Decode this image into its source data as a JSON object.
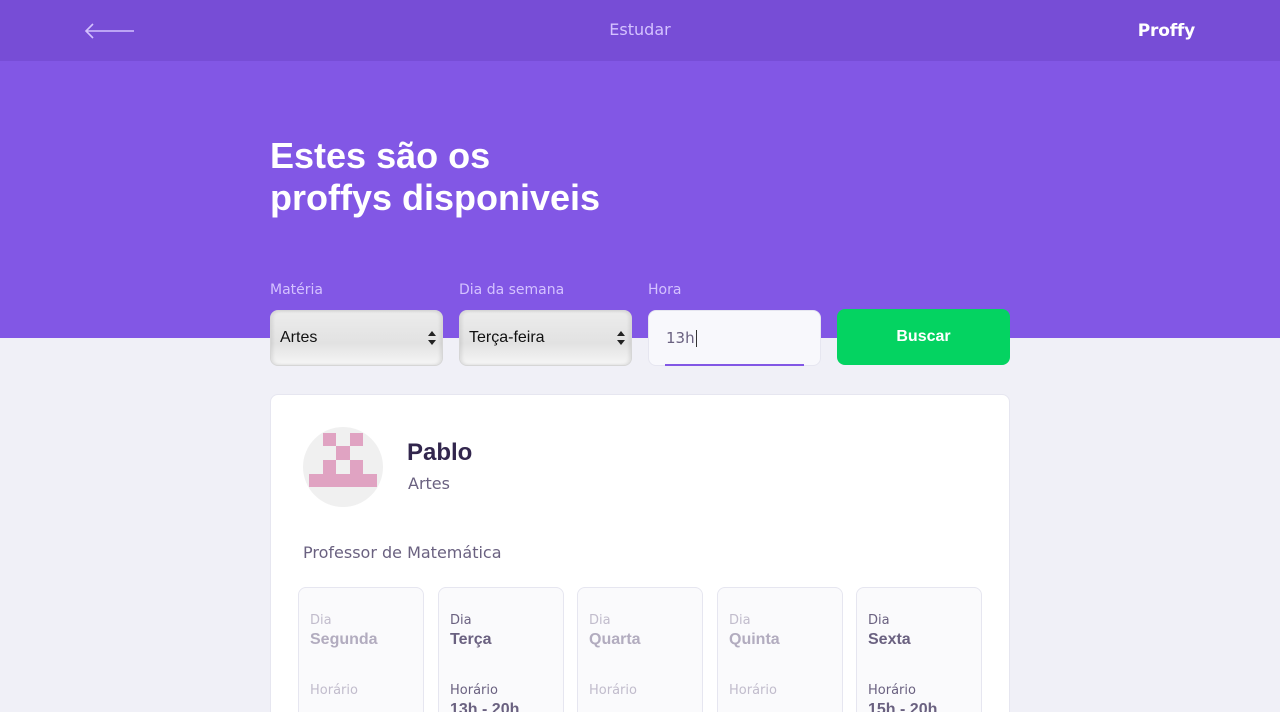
{
  "topbar": {
    "title": "Estudar",
    "logo": "Proffy",
    "back_icon": "arrow-left-icon"
  },
  "hero": {
    "title_line1": "Estes são os",
    "title_line2": "proffys disponiveis"
  },
  "filters": {
    "subject": {
      "label": "Matéria",
      "value": "Artes"
    },
    "weekday": {
      "label": "Dia da semana",
      "value": "Terça-feira"
    },
    "time": {
      "label": "Hora",
      "value": "13h"
    },
    "search_label": "Buscar"
  },
  "teacher": {
    "name": "Pablo",
    "subject": "Artes",
    "bio": "Professor de Matemática",
    "schedule": [
      {
        "day_label": "Dia",
        "day": "Segunda",
        "hour_label": "Horário",
        "hours": "",
        "available": false
      },
      {
        "day_label": "Dia",
        "day": "Terça",
        "hour_label": "Horário",
        "hours": "13h - 20h",
        "available": true
      },
      {
        "day_label": "Dia",
        "day": "Quarta",
        "hour_label": "Horário",
        "hours": "",
        "available": false
      },
      {
        "day_label": "Dia",
        "day": "Quinta",
        "hour_label": "Horário",
        "hours": "",
        "available": false
      },
      {
        "day_label": "Dia",
        "day": "Sexta",
        "hour_label": "Horário",
        "hours": "15h - 20h",
        "available": true
      }
    ]
  },
  "colors": {
    "header": "#774DD6",
    "hero": "#8257E5",
    "button": "#04D361",
    "background": "#F0F0F7",
    "avatar": "#E0A3C2"
  }
}
